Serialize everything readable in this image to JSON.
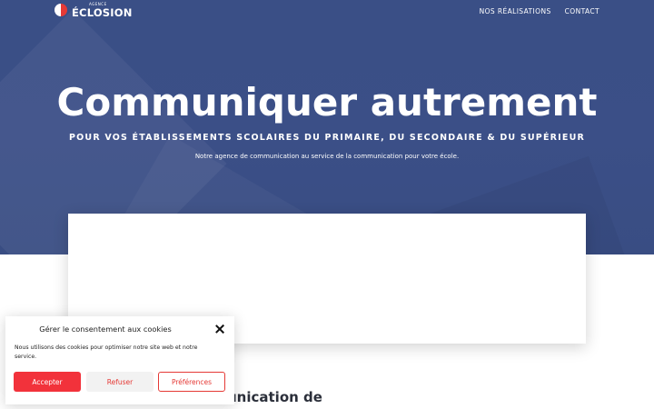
{
  "nav": {
    "logo_small": "AGENCE",
    "logo_main": "ÉCLOSION",
    "links": [
      "NOS RÉALISATIONS",
      "CONTACT"
    ]
  },
  "hero": {
    "title": "Communiquer autrement",
    "subtitle": "POUR VOS ÉTABLISSEMENTS SCOLAIRES DU PRIMAIRE, DU SECONDAIRE & DU SUPÉRIEUR",
    "description": "Notre agence de communication au service de la communication pour votre école."
  },
  "section": {
    "heading": "unication de"
  },
  "cookie": {
    "title": "Gérer le consentement aux cookies",
    "text": "Nous utilisons des cookies pour optimiser notre site web et notre service.",
    "accept": "Accepter",
    "refuse": "Refuser",
    "preferences": "Préférences"
  },
  "colors": {
    "hero_bg": "#3b4f87",
    "accent_red": "#f2323b"
  }
}
